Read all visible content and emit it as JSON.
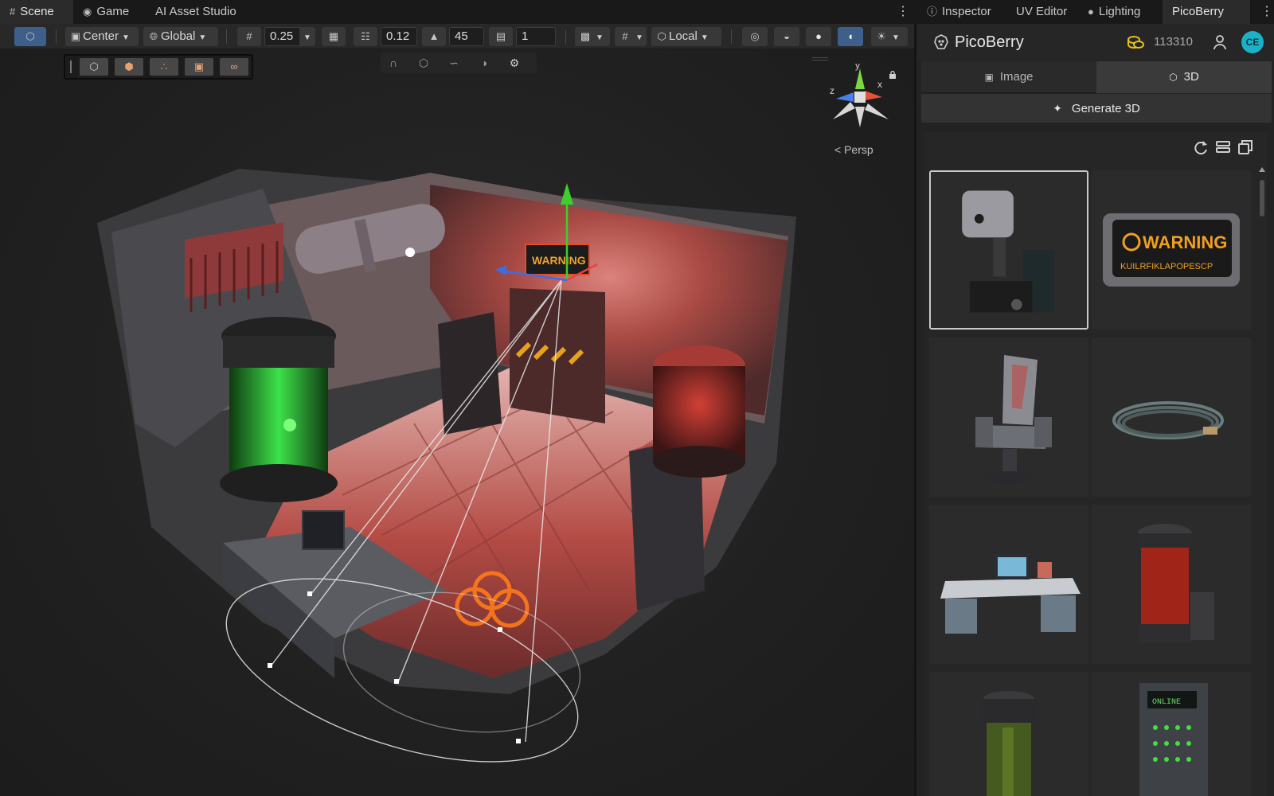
{
  "tabs": {
    "scene": "Scene",
    "game": "Game",
    "ai_asset_studio": "AI Asset Studio",
    "inspector": "Inspector",
    "uv_editor": "UV Editor",
    "lighting": "Lighting",
    "picoberry": "PicoBerry"
  },
  "toolbar": {
    "pivot_mode": "Center",
    "pivot_rotation": "Global",
    "grid_snap_value": "0.25",
    "increment_snap_value": "0.12",
    "rotation_snap_value": "45",
    "scale_snap_value": "1",
    "handle_space": "Local"
  },
  "viewport": {
    "camera_mode": "< Persp",
    "axis_labels": {
      "y": "y",
      "x": "x",
      "z": "z"
    },
    "warning_sign_text": "WARNING"
  },
  "panel": {
    "title": "PicoBerry",
    "credits": "113310",
    "avatar_initials": "CE",
    "mode_tabs": [
      "Image",
      "3D"
    ],
    "active_mode": "3D",
    "generate_label": "Generate 3D",
    "assets": [
      {
        "name": "Robotic arm machine",
        "selected": true
      },
      {
        "name": "Warning sign",
        "label": "WARNING",
        "sublabel": "KUILRFIKLAPOPESCP",
        "selected": false
      },
      {
        "name": "Sci-fi chair",
        "selected": false
      },
      {
        "name": "Coiled cable",
        "selected": false
      },
      {
        "name": "Computer desk",
        "selected": false
      },
      {
        "name": "Red canister",
        "selected": false
      },
      {
        "name": "Green canister",
        "selected": false
      },
      {
        "name": "Server rack",
        "label": "ONLINE",
        "selected": false
      }
    ]
  },
  "colors": {
    "selected_tool": "#3d5f8a",
    "avatar": "#1ab1c9",
    "coin": "#e8c21a",
    "gizmo_green": "#3ecf2e",
    "gizmo_red": "#e8443a",
    "gizmo_blue": "#3a6ee8"
  }
}
